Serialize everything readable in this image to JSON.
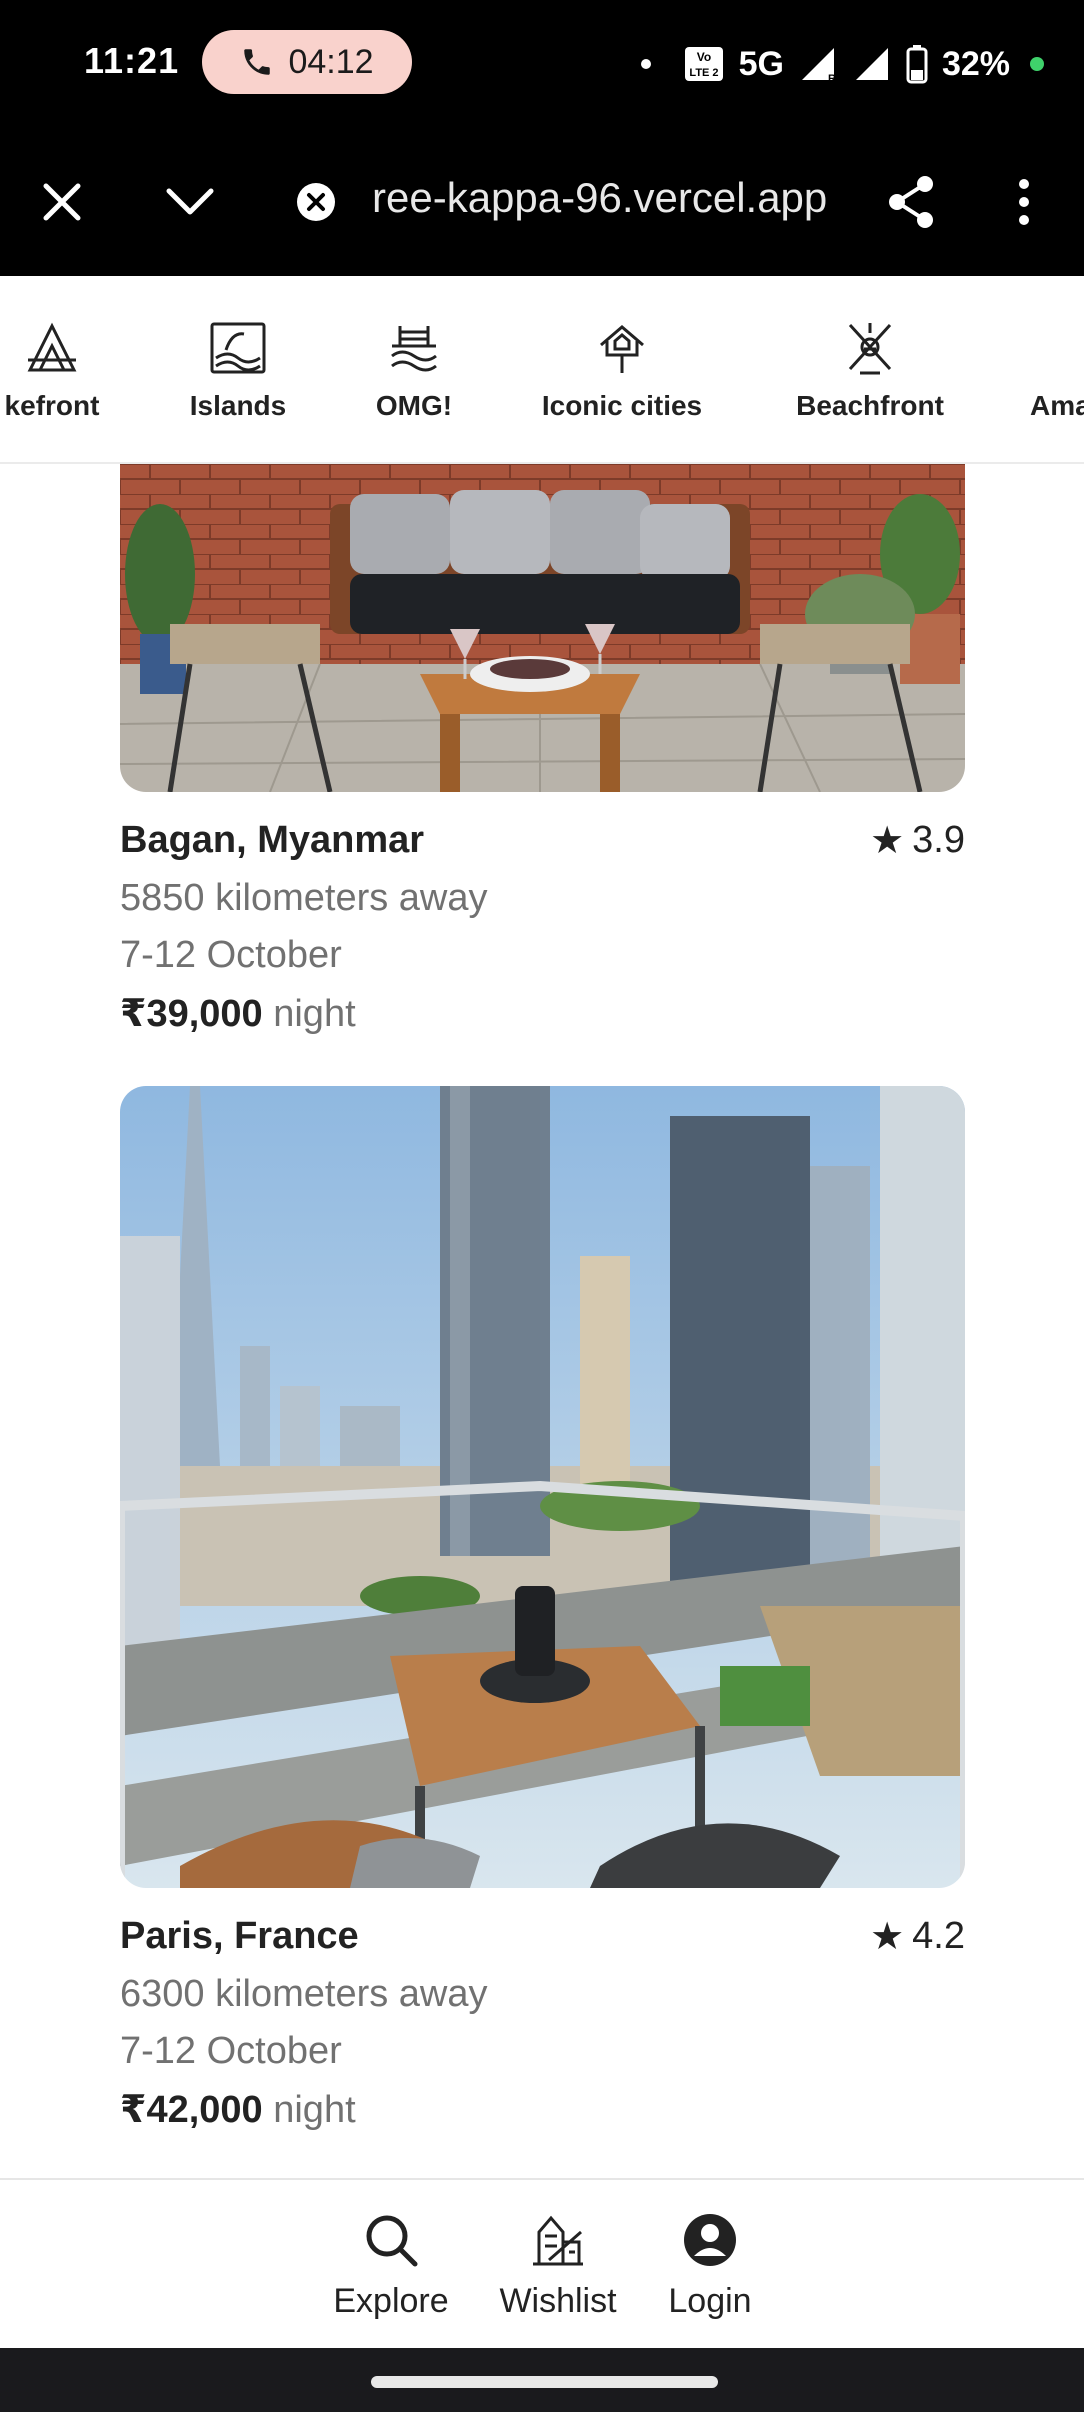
{
  "status_bar": {
    "time": "11:21",
    "call_timer": "04:12",
    "network": "5G",
    "battery": "32%"
  },
  "browser": {
    "url": "ree-kappa-96.vercel.app"
  },
  "categories": [
    {
      "label": "kefront",
      "icon": "lakefront-icon"
    },
    {
      "label": "Islands",
      "icon": "islands-icon"
    },
    {
      "label": "OMG!",
      "icon": "omg-icon"
    },
    {
      "label": "Iconic cities",
      "icon": "iconic-cities-icon"
    },
    {
      "label": "Beachfront",
      "icon": "beachfront-icon"
    },
    {
      "label": "Ama",
      "icon": "amazing-icon"
    }
  ],
  "listings": [
    {
      "location": "Bagan, Myanmar",
      "rating": "3.9",
      "distance": "5850 kilometers away",
      "dates": "7-12 October",
      "price": "₹39,000",
      "price_unit": "night"
    },
    {
      "location": "Paris, France",
      "rating": "4.2",
      "distance": "6300 kilometers away",
      "dates": "7-12 October",
      "price": "₹42,000",
      "price_unit": "night"
    }
  ],
  "bottom_nav": {
    "explore": "Explore",
    "wishlist": "Wishlist",
    "login": "Login"
  },
  "colors": {
    "call_pill": "#f9d2cc",
    "battery_dot": "#3fd16b",
    "muted_text": "#717171"
  }
}
